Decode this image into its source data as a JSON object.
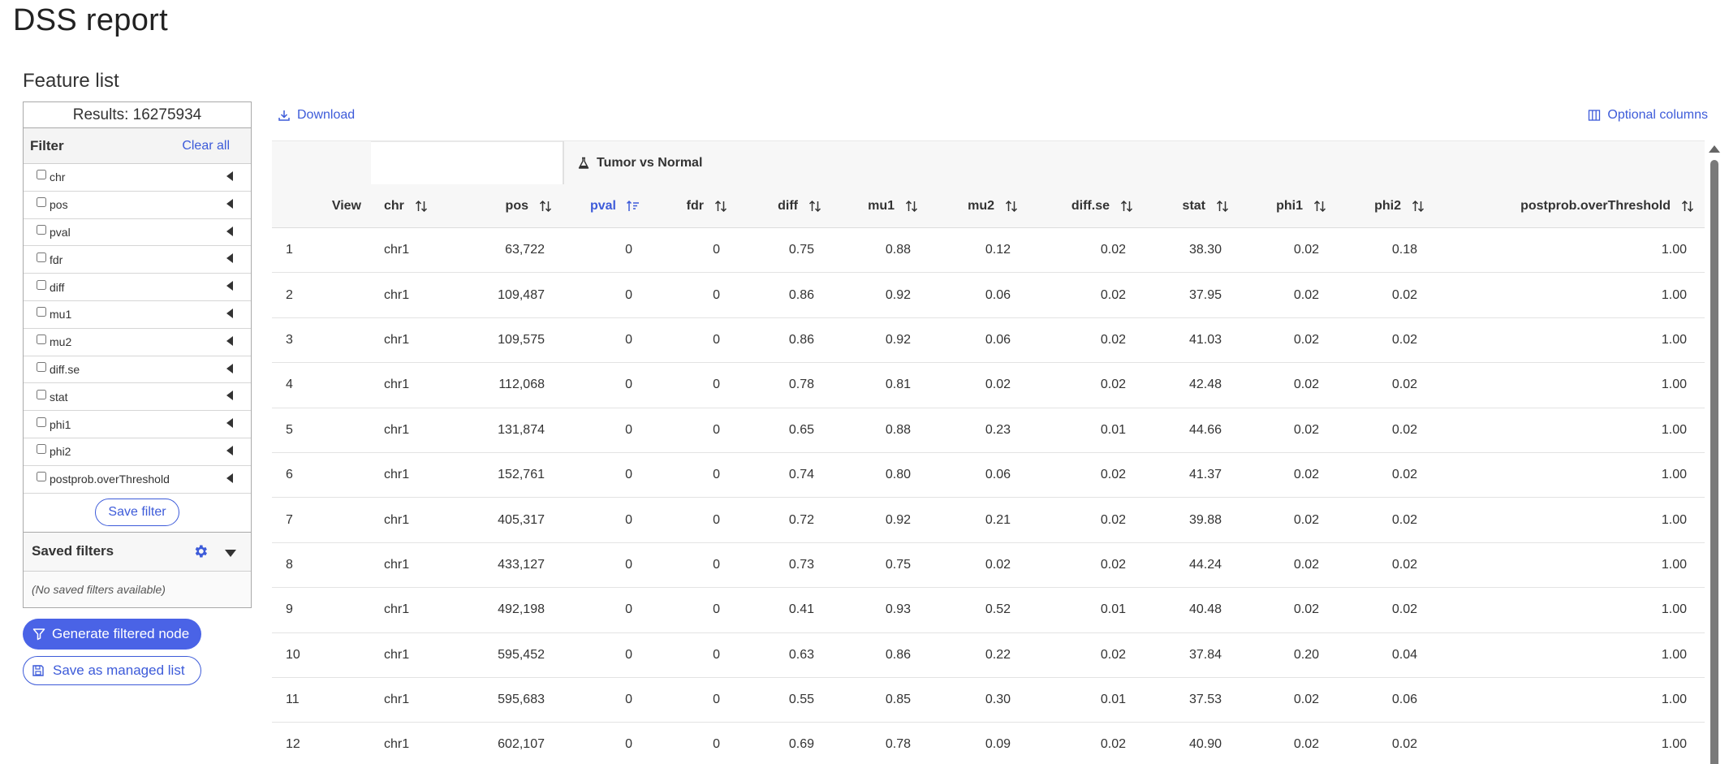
{
  "page": {
    "title": "DSS report",
    "section_title": "Feature list"
  },
  "results_label": "Results: 16275934",
  "filter": {
    "label": "Filter",
    "clear_all": "Clear all",
    "items": [
      {
        "label": "chr"
      },
      {
        "label": "pos"
      },
      {
        "label": "pval"
      },
      {
        "label": "fdr"
      },
      {
        "label": "diff"
      },
      {
        "label": "mu1"
      },
      {
        "label": "mu2"
      },
      {
        "label": "diff.se"
      },
      {
        "label": "stat"
      },
      {
        "label": "phi1"
      },
      {
        "label": "phi2"
      },
      {
        "label": "postprob.overThreshold"
      }
    ],
    "save_filter": "Save filter"
  },
  "saved_filters": {
    "label": "Saved filters",
    "empty": "(No saved filters available)",
    "settings_icon": "gear-icon",
    "toggle_icon": "caret-down-icon"
  },
  "actions": {
    "generate": "Generate filtered node",
    "managed": "Save as managed list"
  },
  "toolbar": {
    "download": "Download",
    "optional_columns": "Optional columns"
  },
  "table": {
    "group_label": "Tumor vs Normal",
    "headers": [
      "View",
      "chr",
      "pos",
      "pval",
      "fdr",
      "diff",
      "mu1",
      "mu2",
      "diff.se",
      "stat",
      "phi1",
      "phi2",
      "postprob.overThreshold"
    ],
    "sorted_column": "pval",
    "rows": [
      [
        "1",
        "chr1",
        "63,722",
        "0",
        "0",
        "0.75",
        "0.88",
        "0.12",
        "0.02",
        "38.30",
        "0.02",
        "0.18",
        "1.00"
      ],
      [
        "2",
        "chr1",
        "109,487",
        "0",
        "0",
        "0.86",
        "0.92",
        "0.06",
        "0.02",
        "37.95",
        "0.02",
        "0.02",
        "1.00"
      ],
      [
        "3",
        "chr1",
        "109,575",
        "0",
        "0",
        "0.86",
        "0.92",
        "0.06",
        "0.02",
        "41.03",
        "0.02",
        "0.02",
        "1.00"
      ],
      [
        "4",
        "chr1",
        "112,068",
        "0",
        "0",
        "0.78",
        "0.81",
        "0.02",
        "0.02",
        "42.48",
        "0.02",
        "0.02",
        "1.00"
      ],
      [
        "5",
        "chr1",
        "131,874",
        "0",
        "0",
        "0.65",
        "0.88",
        "0.23",
        "0.01",
        "44.66",
        "0.02",
        "0.02",
        "1.00"
      ],
      [
        "6",
        "chr1",
        "152,761",
        "0",
        "0",
        "0.74",
        "0.80",
        "0.06",
        "0.02",
        "41.37",
        "0.02",
        "0.02",
        "1.00"
      ],
      [
        "7",
        "chr1",
        "405,317",
        "0",
        "0",
        "0.72",
        "0.92",
        "0.21",
        "0.02",
        "39.88",
        "0.02",
        "0.02",
        "1.00"
      ],
      [
        "8",
        "chr1",
        "433,127",
        "0",
        "0",
        "0.73",
        "0.75",
        "0.02",
        "0.02",
        "44.24",
        "0.02",
        "0.02",
        "1.00"
      ],
      [
        "9",
        "chr1",
        "492,198",
        "0",
        "0",
        "0.41",
        "0.93",
        "0.52",
        "0.01",
        "40.48",
        "0.02",
        "0.02",
        "1.00"
      ],
      [
        "10",
        "chr1",
        "595,452",
        "0",
        "0",
        "0.63",
        "0.86",
        "0.22",
        "0.02",
        "37.84",
        "0.20",
        "0.04",
        "1.00"
      ],
      [
        "11",
        "chr1",
        "595,683",
        "0",
        "0",
        "0.55",
        "0.85",
        "0.30",
        "0.01",
        "37.53",
        "0.02",
        "0.06",
        "1.00"
      ],
      [
        "12",
        "chr1",
        "602,107",
        "0",
        "0",
        "0.69",
        "0.78",
        "0.09",
        "0.02",
        "40.90",
        "0.02",
        "0.02",
        "1.00"
      ]
    ]
  },
  "colors": {
    "accent": "#3d5bd9",
    "primary_button": "#4a63e6",
    "header_bg": "#f7f7f7"
  }
}
